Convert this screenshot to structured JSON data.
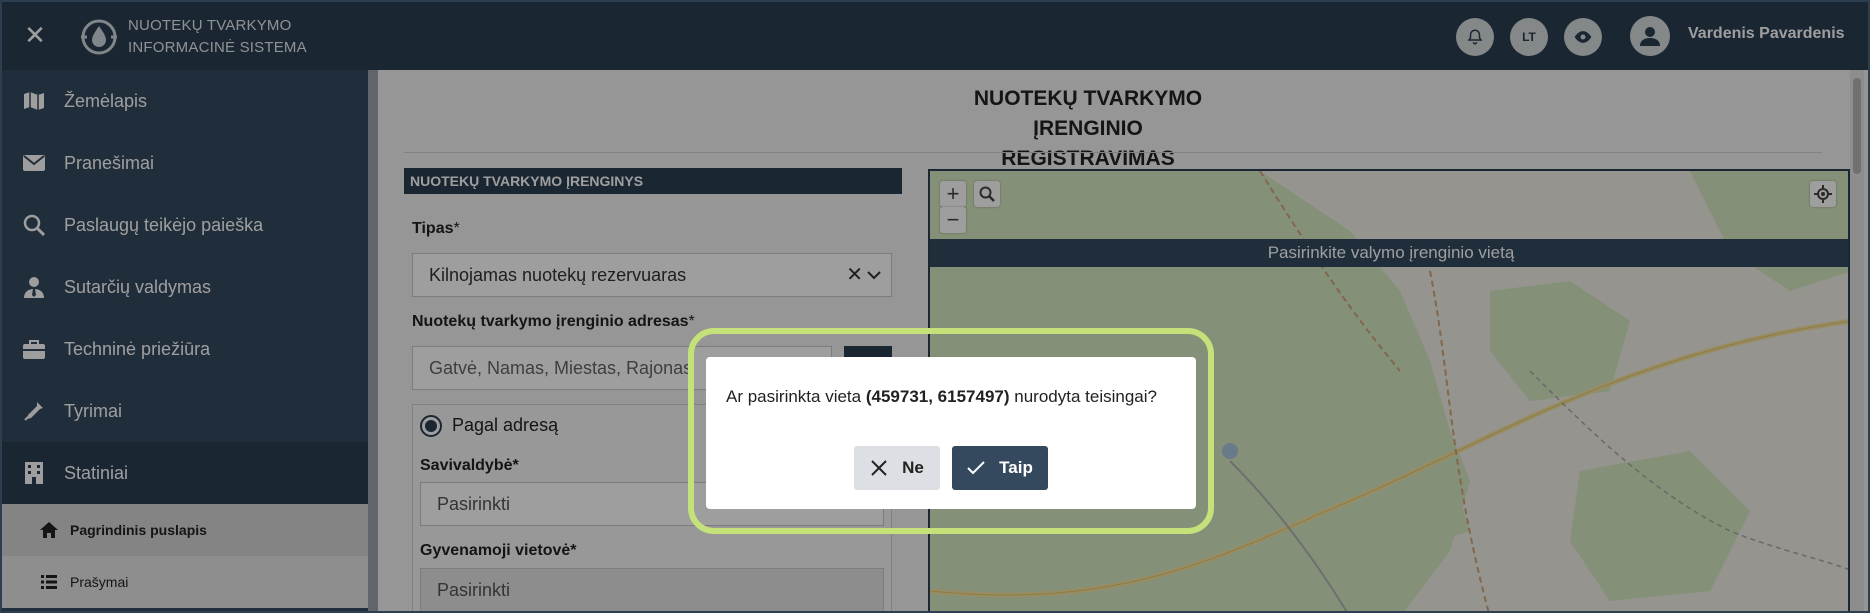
{
  "topbar": {
    "brand_line1": "NUOTEKŲ TVARKYMO",
    "brand_line2": "INFORMACINĖ SISTEMA",
    "lang": "LT",
    "user_name": "Vardenis Pavardenis"
  },
  "sidebar": {
    "items": [
      {
        "label": "Žemėlapis",
        "icon": "map-icon"
      },
      {
        "label": "Pranešimai",
        "icon": "envelope-icon"
      },
      {
        "label": "Paslaugų teikėjo paieška",
        "icon": "search-icon"
      },
      {
        "label": "Sutarčių valdymas",
        "icon": "user-tie-icon"
      },
      {
        "label": "Techninė priežiūra",
        "icon": "briefcase-icon"
      },
      {
        "label": "Tyrimai",
        "icon": "pipette-icon"
      },
      {
        "label": "Statiniai",
        "icon": "building-icon"
      }
    ],
    "subitems": [
      {
        "label": "Pagrindinis puslapis",
        "icon": "home-icon"
      },
      {
        "label": "Prašymai",
        "icon": "list-icon"
      }
    ]
  },
  "page": {
    "title_line1": "NUOTEKŲ TVARKYMO ĮRENGINIO",
    "title_line2": "REGISTRAVIMAS"
  },
  "form": {
    "section_title": "NUOTEKŲ TVARKYMO ĮRENGINYS",
    "type_label": "Tipas",
    "type_value": "Kilnojamas nuotekų rezervuaras",
    "address_label": "Nuotekų tvarkymo įrenginio adresas",
    "address_placeholder": "Gatvė, Namas, Miestas, Rajonas",
    "radio_label": "Pagal adresą",
    "municipality_label": "Savivaldybė*",
    "municipality_value": "Pasirinkti",
    "settlement_label": "Gyvenamoji vietovė*",
    "settlement_value": "Pasirinkti",
    "required_mark": "*"
  },
  "map": {
    "banner": "Pasirinkite valymo įrenginio vietą",
    "zoom_in": "+",
    "zoom_out": "−"
  },
  "dialog": {
    "msg_before": "Ar pasirinkta vieta ",
    "coords": "(459731, 6157497)",
    "msg_after": " nurodyta teisingai?",
    "no_label": "Ne",
    "yes_label": "Taip"
  },
  "colors": {
    "primary": "#2b3e50",
    "sidebar": "#34495e",
    "highlight": "#c5e27a"
  }
}
